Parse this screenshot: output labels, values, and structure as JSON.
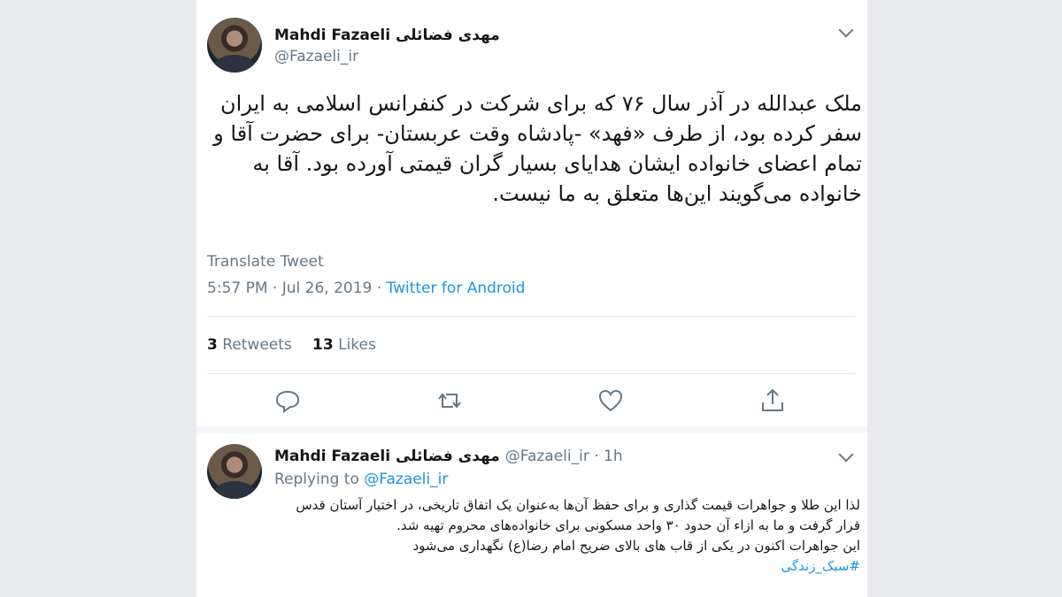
{
  "tweet": {
    "author_name": "Mahdi Fazaeli",
    "author_name_fa": "مهدی فضائلی",
    "handle": "@Fazaeli_ir",
    "text": "ملک عبدالله در آذر سال ۷۶ که برای شرکت در کنفرانس اسلامی به ایران سفر کرده بود، از طرف «فهد» -پادشاه وقت عربستان- برای حضرت آقا و تمام اعضای خانواده ایشان هدایای بسیار گران قیمتی آورده بود. آقا به خانواده می‌گویند این‌ها متعلق به ما نیست.",
    "translate_label": "Translate Tweet",
    "timestamp": "5:57 PM · Jul 26, 2019 · ",
    "source": "Twitter for Android",
    "retweets_count": "3",
    "retweets_label": " Retweets",
    "likes_count": "13",
    "likes_label": " Likes"
  },
  "reply": {
    "author_name": "Mahdi Fazaeli",
    "author_name_fa": "مهدی فضائلی",
    "handle_time": "@Fazaeli_ir · 1h",
    "replying_prefix": "Replying to ",
    "replying_to": "@Fazaeli_ir",
    "line1": "لذا این طلا و جواهرات قیمت گذاری و برای حفظ آن‌ها به‌عنوان یک اتفاق تاریخی، در اختیار آستان قدس",
    "line2": "قرار گرفت و ما به ازاء آن حدود ۳۰ واحد مسکونی برای خانواده‌های محروم تهیه شد.",
    "line3": "این جواهرات اکنون در یکی از قاب های بالای ضریح امام رضا(ع) نگهداری می‌شود",
    "hashtag": "#سبک_زندگی"
  },
  "icons": {
    "reply": "reply-icon",
    "retweet": "retweet-icon",
    "like": "heart-icon",
    "share": "share-icon",
    "menu": "chevron-down-icon"
  },
  "colors": {
    "link": "#1b95e0",
    "muted": "#657786"
  }
}
